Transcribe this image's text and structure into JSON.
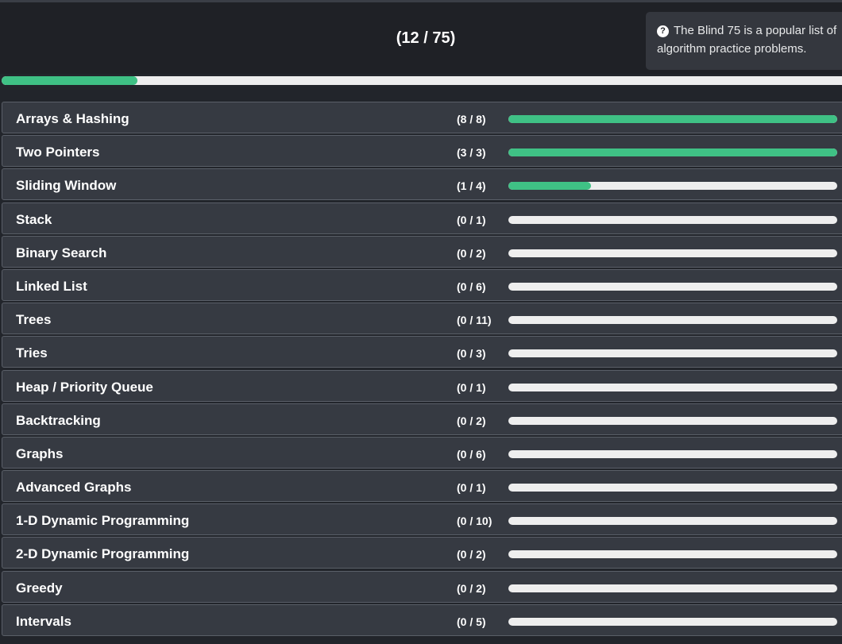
{
  "header": {
    "overall_count": "(12 / 75)",
    "overall_progress": 0.16,
    "info_text": "The Blind 75 is a popular list of algorithm practice problems.",
    "info_icon": "question-circle-icon"
  },
  "colors": {
    "accent": "#3fc185",
    "track": "#eeeeee",
    "row_bg": "#363a42",
    "page_bg": "#22252b"
  },
  "categories": [
    {
      "name": "Arrays & Hashing",
      "count": "(8 / 8)",
      "progress": 1.0
    },
    {
      "name": "Two Pointers",
      "count": "(3 / 3)",
      "progress": 1.0
    },
    {
      "name": "Sliding Window",
      "count": "(1 / 4)",
      "progress": 0.25
    },
    {
      "name": "Stack",
      "count": "(0 / 1)",
      "progress": 0
    },
    {
      "name": "Binary Search",
      "count": "(0 / 2)",
      "progress": 0
    },
    {
      "name": "Linked List",
      "count": "(0 / 6)",
      "progress": 0
    },
    {
      "name": "Trees",
      "count": "(0 / 11)",
      "progress": 0
    },
    {
      "name": "Tries",
      "count": "(0 / 3)",
      "progress": 0
    },
    {
      "name": "Heap / Priority Queue",
      "count": "(0 / 1)",
      "progress": 0
    },
    {
      "name": "Backtracking",
      "count": "(0 / 2)",
      "progress": 0
    },
    {
      "name": "Graphs",
      "count": "(0 / 6)",
      "progress": 0
    },
    {
      "name": "Advanced Graphs",
      "count": "(0 / 1)",
      "progress": 0
    },
    {
      "name": "1-D Dynamic Programming",
      "count": "(0 / 10)",
      "progress": 0
    },
    {
      "name": "2-D Dynamic Programming",
      "count": "(0 / 2)",
      "progress": 0
    },
    {
      "name": "Greedy",
      "count": "(0 / 2)",
      "progress": 0
    },
    {
      "name": "Intervals",
      "count": "(0 / 5)",
      "progress": 0
    }
  ]
}
